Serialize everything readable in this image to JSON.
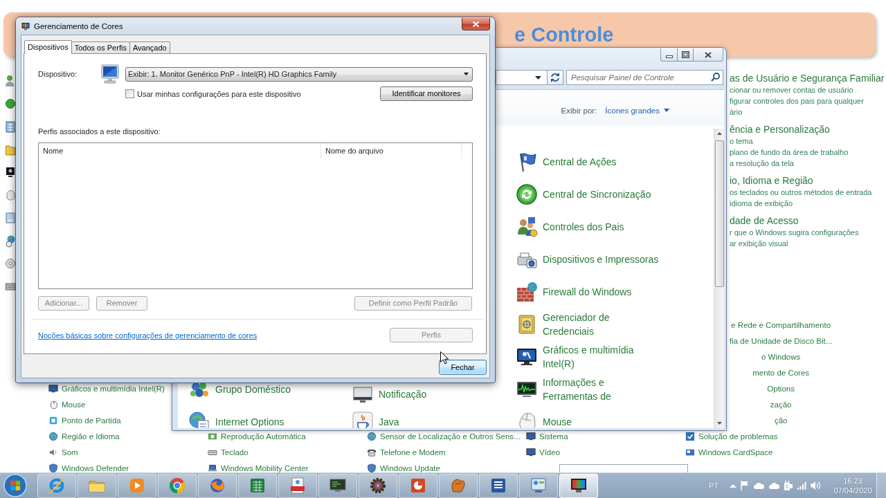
{
  "banner": {
    "title": "e Controle"
  },
  "background_window": {
    "categories": [
      {
        "title": "as de Usuário e Segurança Familiar",
        "links": [
          "cionar ou remover contas de usuário",
          "figurar controles dos pais para qualquer",
          "ário"
        ]
      },
      {
        "title": "ência e Personalização",
        "links": [
          "o tema",
          "plano de fundo da área de trabalho",
          "a resolução da tela"
        ]
      },
      {
        "title": "io, Idioma e Região",
        "links": [
          "os teclados ou outros métodos de entrada",
          "idioma de exibição"
        ]
      },
      {
        "title": "dade de Acesso",
        "links": [
          "r que o Windows sugira configurações",
          "ar exibição visual"
        ]
      }
    ],
    "items_cut_off": [
      "e Rede e Compartilhamento",
      "fia de Unidade de Disco Bit...",
      "o Windows",
      "mento de Cores",
      "Options",
      "zação",
      "ção"
    ],
    "columns": [
      {
        "items": [
          "Gráficos e multimídia Intel(R)",
          "Mouse",
          "Ponto de Partida",
          "Região e Idioma",
          "Som",
          "Windows Defender"
        ]
      },
      {
        "items": [
          "Reprodução Automática",
          "Teclado",
          "Windows Mobility Center"
        ]
      },
      {
        "items": [
          "Sensor de Localização e Outros Sens...",
          "Telefone e Modem",
          "Windows Update"
        ]
      },
      {
        "items": [
          "Sistema",
          "Vídeo"
        ]
      },
      {
        "items": [
          "Solução de problemas",
          "Windows CardSpace"
        ]
      }
    ]
  },
  "control_panel": {
    "search": {
      "placeholder": "Pesquisar Painel de Controle"
    },
    "view_by": {
      "label": "Exibir por:",
      "value": "Ícones grandes"
    },
    "columns": [
      {
        "items": [
          "Grupo Doméstico",
          "Internet Options"
        ]
      },
      {
        "items": [
          "Notificação",
          "Java"
        ]
      },
      {
        "items": [
          "Central de Ações",
          "Central de Sincronização",
          "Controles dos Pais",
          "Dispositivos e Impressoras",
          "Firewall do Windows",
          "Gerenciador de Credenciais",
          "Gráficos e multimídia Intel(R)",
          "Informações e Ferramentas de",
          "Mouse"
        ]
      }
    ]
  },
  "dialog": {
    "title": "Gerenciamento de Cores",
    "tabs": [
      {
        "label": "Dispositivos",
        "selected": true
      },
      {
        "label": "Todos os Perfis",
        "selected": false
      },
      {
        "label": "Avançado",
        "selected": false
      }
    ],
    "device_label": "Dispositivo:",
    "device_select": {
      "value": "Exibir: 1. Monitor Genérico PnP - Intel(R) HD Graphics Family"
    },
    "use_my_settings": {
      "label": "Usar minhas configurações para este dispositivo",
      "checked": false
    },
    "identify_button": {
      "label": "Identificar monitores",
      "disabled": false
    },
    "profiles_label": "Perfis associados a este dispositivo:",
    "profiles_table": {
      "columns": [
        "Nome",
        "Nome do arquivo"
      ]
    },
    "profile_buttons": [
      {
        "label": "Adicionar...",
        "disabled": true
      },
      {
        "label": "Remover",
        "disabled": true
      },
      {
        "label": "Definir como Perfil Padrão",
        "disabled": true
      }
    ],
    "help_link": "Noções básicas sobre configurações de gerenciamento de cores",
    "profiles_button": {
      "label": "Perfis",
      "disabled": true
    },
    "close_button": {
      "label": "Fechar",
      "disabled": false,
      "focused": true
    }
  },
  "taskbar": {
    "apps": [
      {
        "selected": false
      },
      {
        "selected": false
      },
      {
        "selected": false
      },
      {
        "selected": false
      },
      {
        "selected": false
      },
      {
        "selected": false
      },
      {
        "selected": false
      },
      {
        "selected": false
      },
      {
        "selected": false
      },
      {
        "selected": false
      },
      {
        "selected": false
      },
      {
        "selected": false
      },
      {
        "selected": false
      },
      {
        "selected": true
      }
    ],
    "language": "PT",
    "time": "16:23",
    "date": "07/04/2020"
  }
}
